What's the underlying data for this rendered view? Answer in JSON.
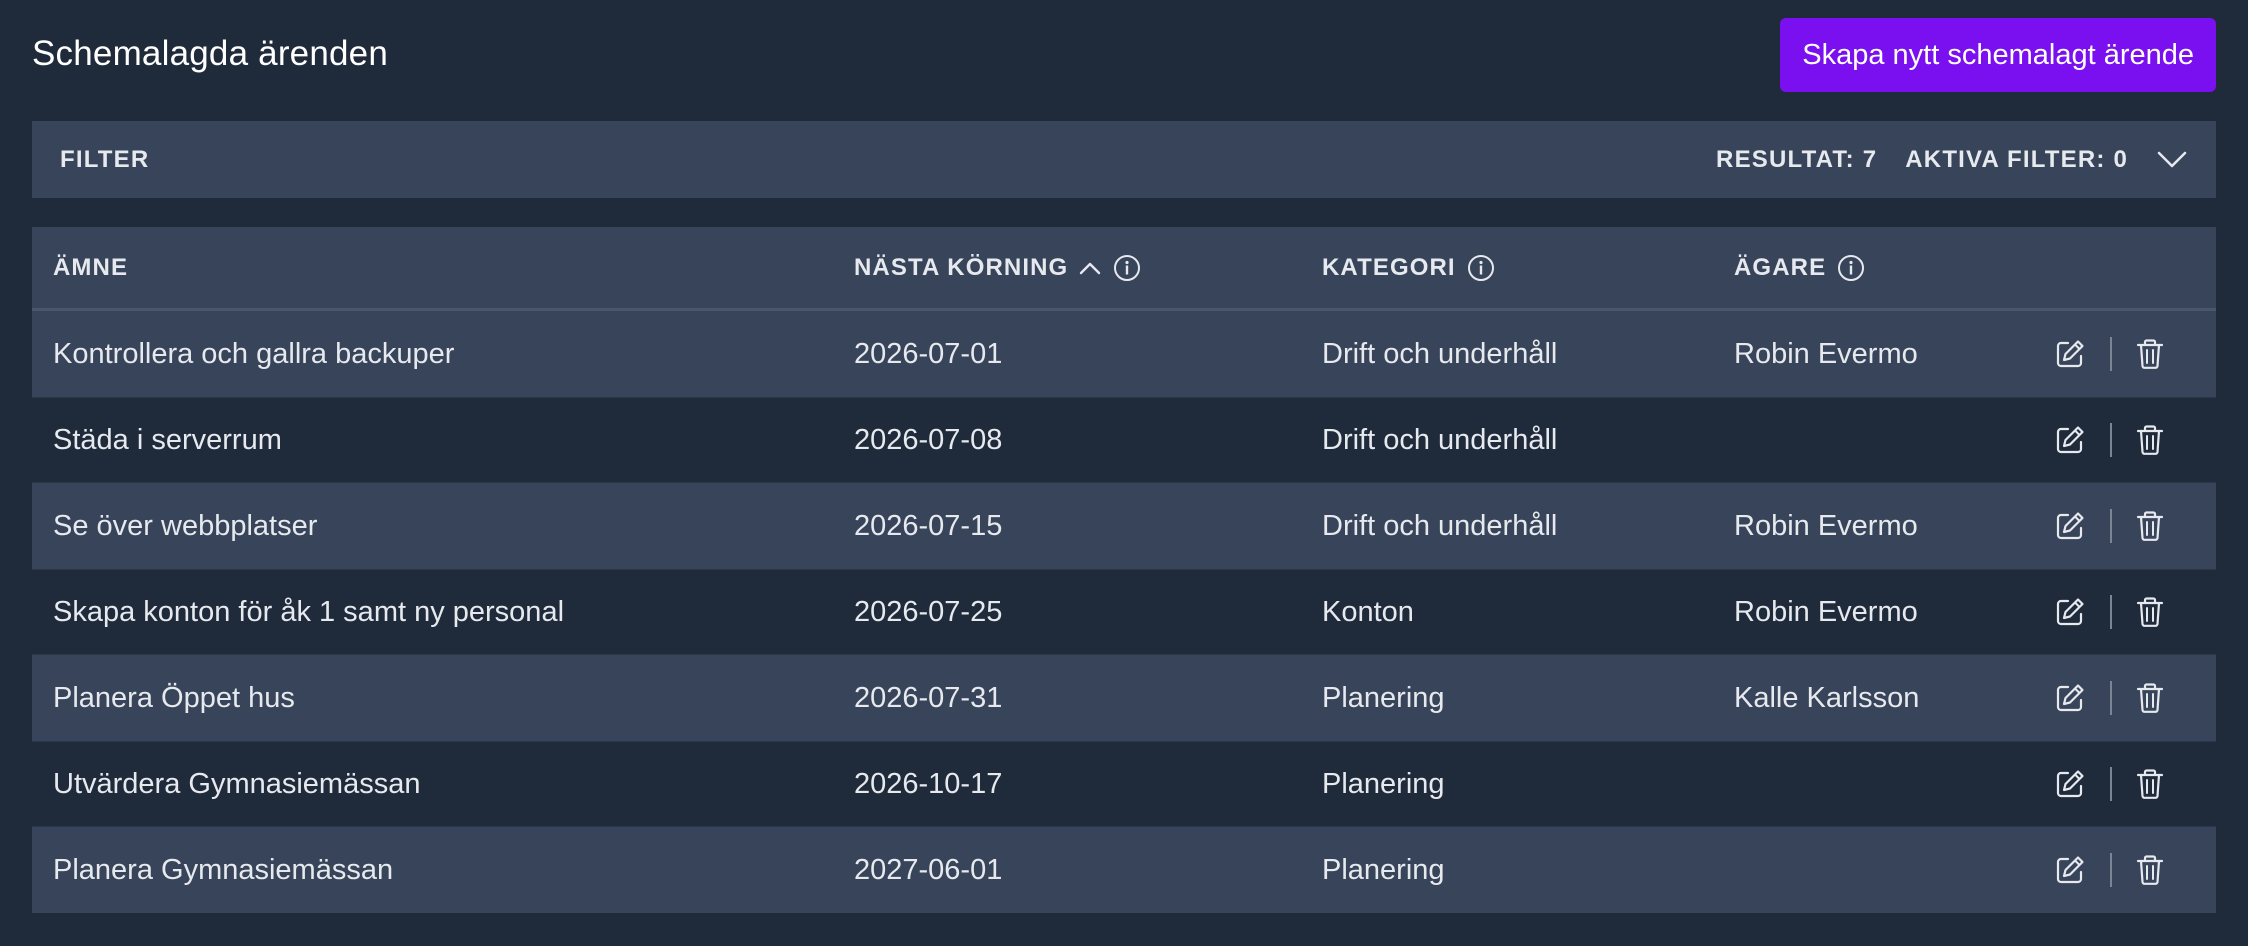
{
  "header": {
    "title": "Schemalagda ärenden",
    "create_label": "Skapa nytt schemalagt ärende"
  },
  "filter": {
    "label": "FILTER",
    "results": "RESULTAT: 7",
    "active": "AKTIVA FILTER: 0"
  },
  "table": {
    "columns": {
      "subject": "ÄMNE",
      "next_run": "NÄSTA KÖRNING",
      "category": "KATEGORI",
      "owner": "ÄGARE"
    },
    "rows": [
      {
        "subject": "Kontrollera och gallra backuper",
        "next_run": "2026-07-01",
        "category": "Drift och underhåll",
        "owner": "Robin Evermo"
      },
      {
        "subject": "Städa i serverrum",
        "next_run": "2026-07-08",
        "category": "Drift och underhåll",
        "owner": ""
      },
      {
        "subject": "Se över webbplatser",
        "next_run": "2026-07-15",
        "category": "Drift och underhåll",
        "owner": "Robin Evermo"
      },
      {
        "subject": "Skapa konton för åk 1 samt ny personal",
        "next_run": "2026-07-25",
        "category": "Konton",
        "owner": "Robin Evermo"
      },
      {
        "subject": "Planera Öppet hus",
        "next_run": "2026-07-31",
        "category": "Planering",
        "owner": "Kalle Karlsson"
      },
      {
        "subject": "Utvärdera Gymnasiemässan",
        "next_run": "2026-10-17",
        "category": "Planering",
        "owner": ""
      },
      {
        "subject": "Planera Gymnasiemässan",
        "next_run": "2027-06-01",
        "category": "Planering",
        "owner": ""
      }
    ]
  },
  "icons": {
    "sort": "chevron-up-icon",
    "info": "info-icon",
    "expand": "chevron-down-icon",
    "edit": "edit-icon",
    "delete": "trash-icon"
  },
  "colors": {
    "background": "#1f2a3b",
    "panel": "#384459",
    "accent": "#7a0ff0",
    "text": "#e6e9ee"
  }
}
